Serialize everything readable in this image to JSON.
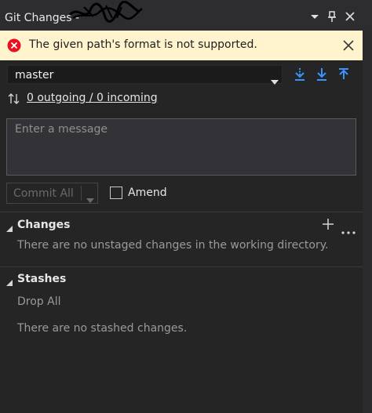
{
  "window": {
    "title": "Git Changes -",
    "controls": [
      "chevron-down-icon",
      "pin-icon",
      "close-icon"
    ]
  },
  "error_banner": {
    "icon": "error-icon",
    "message": "The given path's format is not supported.",
    "close_icon": "close-icon",
    "background": "#fff4ce",
    "icon_color": "#e81123"
  },
  "branch": {
    "name": "master",
    "actions": [
      "fetch-icon",
      "pull-icon",
      "push-icon"
    ],
    "action_color": "#3794ff"
  },
  "sync": {
    "icon": "sync-arrows-icon",
    "link_text": "0 outgoing / 0 incoming"
  },
  "commit_box": {
    "placeholder": "Enter a message",
    "commit_label": "Commit All",
    "amend_label": "Amend",
    "amend_checked": false
  },
  "changes": {
    "title": "Changes",
    "empty_text": "There are no unstaged changes in the working directory.",
    "actions": [
      "plus-icon",
      "more-icon"
    ]
  },
  "stashes": {
    "title": "Stashes",
    "drop_all_label": "Drop All",
    "empty_text": "There are no stashed changes."
  }
}
